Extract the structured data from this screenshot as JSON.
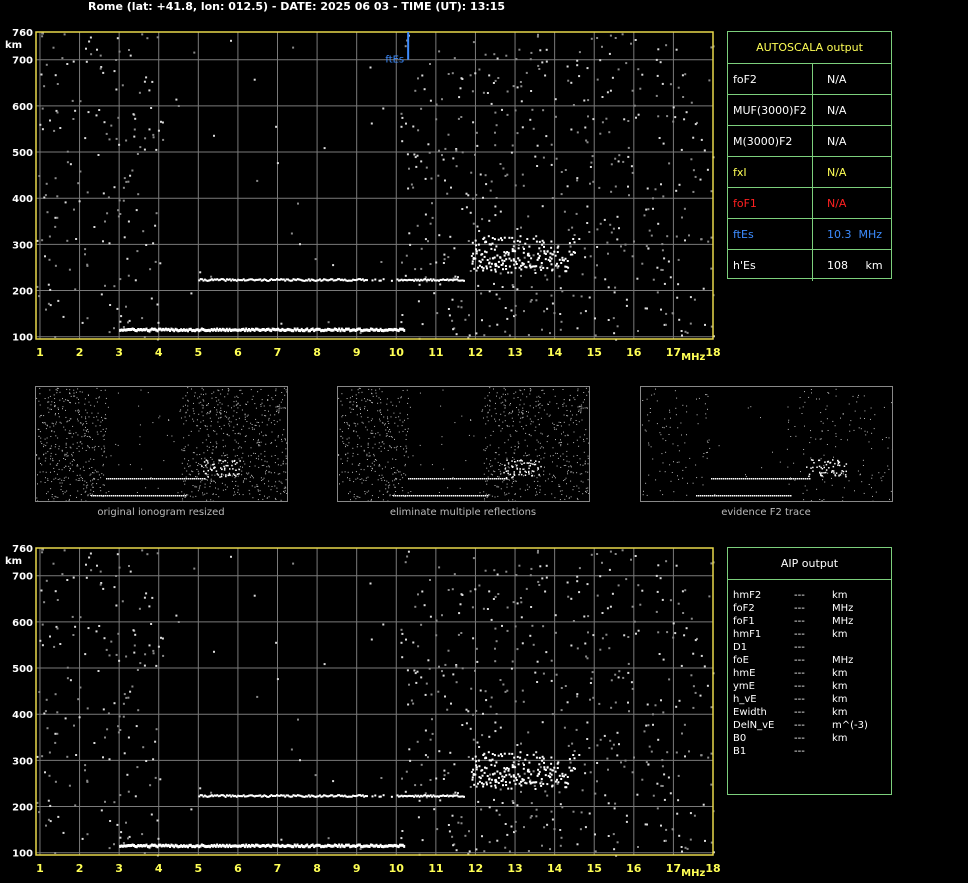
{
  "header": {
    "title": "Rome (lat: +41.8, lon: 012.5) - DATE: 2025 06 03 - TIME (UT): 13:15"
  },
  "colors": {
    "frame": "#e8d84a",
    "grid": "#7a7a7a",
    "table_border": "#7ccf7c",
    "yellow": "#ffff55",
    "red": "#ff2020",
    "blue": "#3d8cff",
    "white": "#ffffff"
  },
  "chart_data": [
    {
      "type": "scatter",
      "title": "",
      "xlabel": "MHz",
      "ylabel": "km",
      "xlim": [
        0.9,
        18
      ],
      "ylim": [
        95,
        760
      ],
      "x_ticks": [
        1,
        2,
        3,
        4,
        5,
        6,
        7,
        8,
        9,
        10,
        11,
        12,
        13,
        14,
        15,
        16,
        17,
        18
      ],
      "y_ticks": [
        100,
        200,
        300,
        400,
        500,
        600,
        700,
        760
      ],
      "grid": true,
      "annotation": {
        "label": "ftEs",
        "x": 10.3,
        "y_from": 700,
        "y_to": 760
      },
      "traces": [
        {
          "name": "",
          "x_from": 3.0,
          "x_to": 10.2,
          "y": 118
        },
        {
          "name": "",
          "x_from": 5.0,
          "x_to": 11.7,
          "y": 225
        },
        {
          "name": "",
          "x_from": 11.9,
          "x_to": 14.5,
          "y": 270
        }
      ]
    },
    {
      "type": "scatter",
      "title": "",
      "xlabel": "MHz",
      "ylabel": "km",
      "xlim": [
        0.9,
        18
      ],
      "ylim": [
        95,
        760
      ],
      "x_ticks": [
        1,
        2,
        3,
        4,
        5,
        6,
        7,
        8,
        9,
        10,
        11,
        12,
        13,
        14,
        15,
        16,
        17,
        18
      ],
      "y_ticks": [
        100,
        200,
        300,
        400,
        500,
        600,
        700,
        760
      ],
      "grid": true,
      "traces": [
        {
          "name": "",
          "x_from": 3.0,
          "x_to": 10.2,
          "y": 118
        },
        {
          "name": "",
          "x_from": 5.0,
          "x_to": 11.7,
          "y": 225
        },
        {
          "name": "",
          "x_from": 11.9,
          "x_to": 14.5,
          "y": 270
        }
      ]
    }
  ],
  "autoscala": {
    "title": "AUTOSCALA output",
    "rows": [
      {
        "label": "foF2",
        "value": "N/A",
        "color": "#ffffff"
      },
      {
        "label": "MUF(3000)F2",
        "value": "N/A",
        "color": "#ffffff"
      },
      {
        "label": "M(3000)F2",
        "value": "N/A",
        "color": "#ffffff"
      },
      {
        "label": "fxI",
        "value": "N/A",
        "color": "#ffff55"
      },
      {
        "label": "foF1",
        "value": "N/A",
        "color": "#ff2020"
      },
      {
        "label": "ftEs",
        "value": "10.3  MHz",
        "color": "#3d8cff"
      },
      {
        "label": "h'Es",
        "value": "108     km",
        "color": "#ffffff"
      }
    ]
  },
  "thumbnails": [
    {
      "caption": "original ionogram resized"
    },
    {
      "caption": "eliminate multiple reflections"
    },
    {
      "caption": "evidence F2 trace"
    }
  ],
  "aip": {
    "title": "AIP output",
    "rows": [
      {
        "name": "hmF2",
        "value": "---",
        "unit": "km"
      },
      {
        "name": "foF2",
        "value": "---",
        "unit": "MHz"
      },
      {
        "name": "foF1",
        "value": "---",
        "unit": "MHz"
      },
      {
        "name": "hmF1",
        "value": "---",
        "unit": "km"
      },
      {
        "name": "D1",
        "value": "---",
        "unit": ""
      },
      {
        "name": "foE",
        "value": "---",
        "unit": "MHz"
      },
      {
        "name": "hmE",
        "value": "---",
        "unit": "km"
      },
      {
        "name": "ymE",
        "value": "---",
        "unit": "km"
      },
      {
        "name": "h_vE",
        "value": "---",
        "unit": "km"
      },
      {
        "name": "Ewidth",
        "value": "---",
        "unit": "km"
      },
      {
        "name": "DelN_vE",
        "value": "---",
        "unit": "m^(-3)"
      },
      {
        "name": "B0",
        "value": "---",
        "unit": "km"
      },
      {
        "name": "B1",
        "value": "---",
        "unit": ""
      }
    ]
  }
}
